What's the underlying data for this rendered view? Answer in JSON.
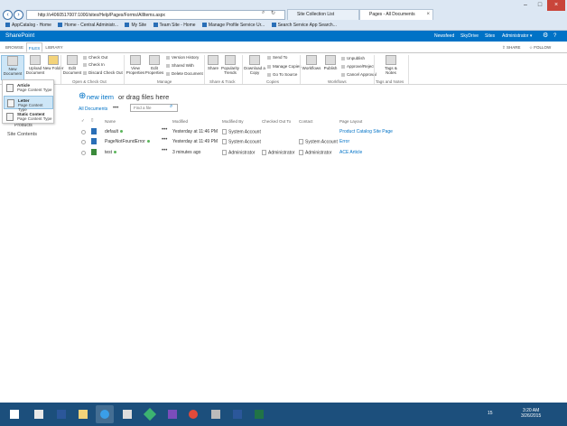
{
  "browser": {
    "address": "http://v4060517007:1000/sites/Help/Pages/Forms/AllItems.aspx",
    "tabs": [
      {
        "label": "Site Collection List"
      },
      {
        "label": "Pages - All Documents"
      }
    ],
    "favorites": [
      "AppCatalog - Home",
      "Home - Central Administr...",
      "My Site",
      "Team Site - Home",
      "Manage Profile Service Ur...",
      "Search Service App Search..."
    ]
  },
  "suite": {
    "brand": "SharePoint",
    "links": [
      "Newsfeed",
      "SkyDrive",
      "Sites"
    ],
    "user": "Administrator ▾",
    "gear_icon": "gear-icon",
    "help": "?"
  },
  "ribbon": {
    "tabs": [
      "BROWSE",
      "FILES",
      "LIBRARY"
    ],
    "share": "SHARE",
    "follow": "FOLLOW",
    "new_document": "New Document",
    "upload_document": "Upload Document",
    "new_folder": "New Folder",
    "edit_document": "Edit Document",
    "check_out": "Check Out",
    "check_in": "Check In",
    "discard_check_out": "Discard Check Out",
    "grp_open": "Open & Check Out",
    "view_properties": "View Properties",
    "edit_properties": "Edit Properties",
    "version_history": "Version History",
    "shared_with": "Shared With",
    "delete_document": "Delete Document",
    "grp_manage": "Manage",
    "share_btn": "Share",
    "popularity_trends": "Popularity Trends",
    "grp_share": "Share & Track",
    "download_copy": "Download a Copy",
    "send_to": "Send To",
    "manage_copies": "Manage Copies",
    "go_to_source": "Go To Source",
    "grp_copies": "Copies",
    "workflows": "Workflows",
    "publish": "Publish",
    "unpublish": "Unpublish",
    "approve_reject": "Approve/Reject",
    "cancel_approval": "Cancel Approval",
    "grp_workflows": "Workflows",
    "tags_notes": "Tags & Notes",
    "grp_tags": "Tags and Notes"
  },
  "new_menu": [
    {
      "title": "Article",
      "sub": "Page Content Type"
    },
    {
      "title": "Letter",
      "sub": "Page Content Type"
    },
    {
      "title": "Static Content",
      "sub": "Page Content Type"
    }
  ],
  "nav": {
    "products": "Products",
    "site_contents": "Site Contents"
  },
  "main": {
    "new_item": "new item",
    "or_drag": "or drag files here",
    "all_documents": "All Documents",
    "ellipsis": "•••",
    "find_placeholder": "Find a file",
    "columns": [
      "Name",
      "Modified",
      "Modified By",
      "Checked Out To",
      "Contact",
      "Page Layout"
    ],
    "rows": [
      {
        "name": "default",
        "modified": "Yesterday at 11:46 PM",
        "modified_by": "System Account",
        "checked_out": "",
        "contact": "",
        "layout": "Product Catalog Site Page"
      },
      {
        "name": "PageNotFoundError",
        "modified": "Yesterday at 11:49 PM",
        "modified_by": "System Account",
        "checked_out": "",
        "contact": "System Account",
        "layout": "Error"
      },
      {
        "name": "test",
        "modified": "3 minutes ago",
        "modified_by": "Administrator",
        "checked_out": "Administrator",
        "contact": "Administrator",
        "layout": "ACE Article"
      }
    ]
  },
  "taskbar": {
    "time": "3:20 AM",
    "date": "3/26/2015",
    "tray": "15"
  }
}
